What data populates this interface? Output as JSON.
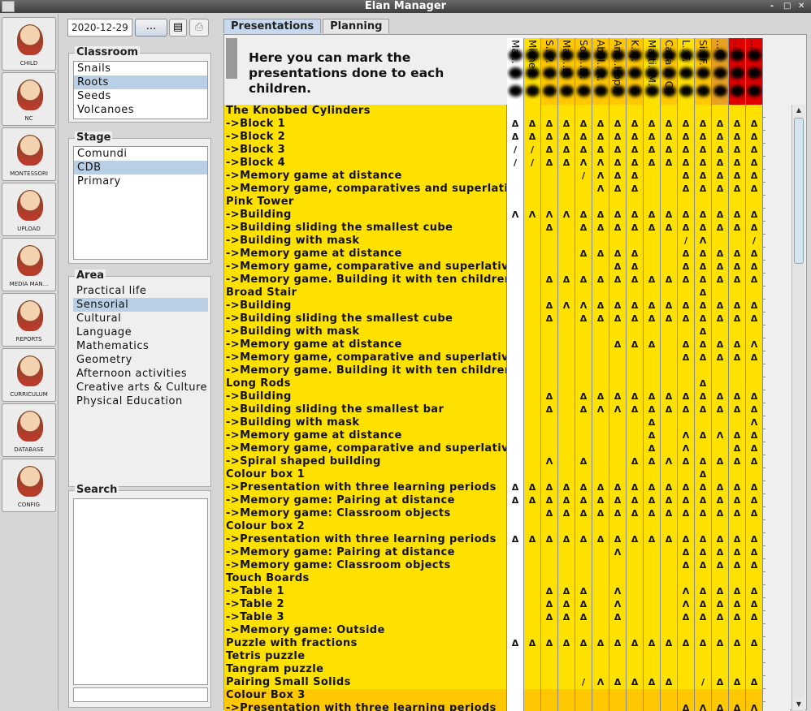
{
  "window": {
    "title": "Elan Manager",
    "controls": [
      "-",
      "□",
      "✕"
    ]
  },
  "sidebar": {
    "items": [
      {
        "label": "CHILD",
        "icon": "child-icon"
      },
      {
        "label": "NC",
        "icon": "nc-icon"
      },
      {
        "label": "MONTESSORI",
        "icon": "montessori-icon"
      },
      {
        "label": "UPLOAD",
        "icon": "upload-icon"
      },
      {
        "label": "MEDIA MAN...",
        "icon": "media-manager-icon"
      },
      {
        "label": "REPORTS",
        "icon": "reports-icon"
      },
      {
        "label": "CURRICULUM",
        "icon": "curriculum-icon"
      },
      {
        "label": "DATABASE",
        "icon": "database-icon"
      },
      {
        "label": "CONFIG",
        "icon": "config-icon"
      }
    ]
  },
  "toolbar": {
    "date": "2020-12-29",
    "dots_label": "...",
    "doc_icon": "document-icon",
    "print_icon": "print-icon"
  },
  "classroom": {
    "title": "Classroom",
    "items": [
      "Snails",
      "Roots",
      "Seeds",
      "Volcanoes"
    ],
    "selected": 1
  },
  "stage": {
    "title": "Stage",
    "items": [
      "Comundi",
      "CDB",
      "Primary"
    ],
    "selected": 1
  },
  "area": {
    "title": "Area",
    "items": [
      "Practical life",
      "Sensorial",
      "Cultural",
      "Language",
      "Mathematics",
      "Geometry",
      "Afternoon activities",
      "Creative arts & Culture",
      "Physical Education"
    ],
    "selected": 1
  },
  "search": {
    "title": "Search",
    "value": ""
  },
  "tabs": [
    {
      "label": "Presentations",
      "active": true
    },
    {
      "label": "Planning",
      "active": false
    }
  ],
  "header": {
    "text": "Here you can mark the presentations done to each children."
  },
  "students": [
    {
      "name": "Ma…"
    },
    {
      "name": "Miche…"
    },
    {
      "name": "S…P."
    },
    {
      "name": "Mar…D."
    },
    {
      "name": "Sofi…M."
    },
    {
      "name": "Abril…R."
    },
    {
      "name": "Ant…Hop."
    },
    {
      "name": "K…J."
    },
    {
      "name": "Marti…M."
    },
    {
      "name": "Carla A. C."
    },
    {
      "name": "L…F."
    },
    {
      "name": "Si…F."
    },
    {
      "name": "…G."
    },
    {
      "name": "…"
    },
    {
      "name": "…"
    }
  ],
  "colors": {
    "yellow": "#ffe100",
    "orange": "#ffc800",
    "dark_orange": "#e8a020",
    "red": "#e00000",
    "white": "#ffffff"
  },
  "rows": [
    {
      "label": "The Knobbed Cylinders",
      "cells": ""
    },
    {
      "label": "->Block 1",
      "cells": "ΔΔΔΔΔΔΔΔΔΔΔΔΔΔΔ"
    },
    {
      "label": "->Block 2",
      "cells": "ΔΔΔΔΔΔΔΔΔΔΔΔΔΔΔ"
    },
    {
      "label": "->Block 3",
      "cells": "//ΔΔΔΔΔΔΔΔΔΔΔΔΔ"
    },
    {
      "label": "->Block 4",
      "cells": "//ΔΔΛΛΔΔΔΔΔΔΔΔΔ"
    },
    {
      "label": "->Memory game at distance",
      "cells": "    /ΛΔΔ  ΔΔΔΔΔ"
    },
    {
      "label": "->Memory game, comparatives and superlatives",
      "cells": "     ΛΔΔ  ΔΔΔΔΔ"
    },
    {
      "label": "Pink Tower",
      "cells": ""
    },
    {
      "label": "->Building",
      "cells": "ΛΛΛΛΔΔΔΔΔΔΔΔΔΔΔ"
    },
    {
      "label": "->Building sliding the smallest cube",
      "cells": "  Δ ΔΔΔΔΔΔΔΔΔΔΔ"
    },
    {
      "label": "->Building with mask",
      "cells": "          /Λ  /"
    },
    {
      "label": "->Memory game at distance",
      "cells": "    ΔΔΔΔ  ΔΔΔΔΔ"
    },
    {
      "label": "->Memory game, comparative and superlative",
      "cells": "      ΔΔ  ΔΔΔΔΔ"
    },
    {
      "label": "->Memory game. Building it with ten children",
      "cells": "  ΔΔΔΔΔΔΔΔΔΔΔΔΔ"
    },
    {
      "label": "Broad Stair",
      "cells": "           Δ   "
    },
    {
      "label": "->Building",
      "cells": "  ΔΛΛΔΔΔΔΔΔΔΔΔΔ"
    },
    {
      "label": "->Building sliding the smallest cube",
      "cells": "  Δ ΔΔΔΔΔΔΔΔΔΔΔ"
    },
    {
      "label": "->Building with mask",
      "cells": "           Δ   "
    },
    {
      "label": "->Memory game at distance",
      "cells": "      ΔΔΔ ΔΔΔΔΛ"
    },
    {
      "label": "->Memory game, comparative and superlative",
      "cells": "          ΔΔΔΔΔ"
    },
    {
      "label": "->Memory game. Building it with ten children",
      "cells": ""
    },
    {
      "label": "Long Rods",
      "cells": "           Δ   "
    },
    {
      "label": "->Building",
      "cells": "  Δ ΔΔΔΔΔΔΔΔΔΔΔ"
    },
    {
      "label": "->Building sliding the smallest bar",
      "cells": "  Δ ΔΛΛΔΔΔΔΔΔΔΔ"
    },
    {
      "label": "->Building with mask",
      "cells": "        Δ     Λ"
    },
    {
      "label": "->Memory game at distance",
      "cells": "        Δ ΛΔΛΔΔ"
    },
    {
      "label": "->Memory game, comparative and superlative",
      "cells": "        Δ Λ  ΔΔ"
    },
    {
      "label": "->Spiral shaped building",
      "cells": "  Λ Δ  ΔΔΛΔΔΔΔΔ"
    },
    {
      "label": "Colour box 1",
      "cells": "           Δ   "
    },
    {
      "label": "->Presentation with three learning periods",
      "cells": "ΔΔΔΔΔΔΔΔΔΔΔΔΔΔΔ"
    },
    {
      "label": "->Memory game: Pairing at distance",
      "cells": "ΔΔΔΔΔΔΔΔΔΔΔΔΔΔΔ"
    },
    {
      "label": "->Memory game: Classroom objects",
      "cells": "  ΔΔΔΔΔΔΔΔΔΔΔΔΔ"
    },
    {
      "label": "Colour box 2",
      "cells": ""
    },
    {
      "label": "->Presentation with three learning periods",
      "cells": "ΔΔΔΔΔΔΔΔΔΔΔΔΔΔΔ"
    },
    {
      "label": "->Memory game: Pairing at distance",
      "cells": "      Λ   ΔΔΔΔΔ"
    },
    {
      "label": "->Memory game: Classroom objects",
      "cells": "          ΔΔΔΔΔ"
    },
    {
      "label": "Touch Boards",
      "cells": ""
    },
    {
      "label": "->Table 1",
      "cells": "  ΔΔΔ Λ   ΛΔΔΔΔ"
    },
    {
      "label": "->Table 2",
      "cells": "  ΔΔΔ Λ   ΛΔΔΔΔ"
    },
    {
      "label": "->Table 3",
      "cells": "  ΔΔΔ Δ   ΔΔΔΔΔ"
    },
    {
      "label": "->Memory game: Outside",
      "cells": ""
    },
    {
      "label": "Puzzle with fractions",
      "cells": "ΔΔΔΔΔΔΔΔΔΔΔΔΔΔΔ"
    },
    {
      "label": "Tetris puzzle",
      "cells": ""
    },
    {
      "label": "Tangram puzzle",
      "cells": ""
    },
    {
      "label": "Pairing Small Solids",
      "cells": "    /ΛΔΔΔΔ /ΔΔΔ"
    },
    {
      "label": "Colour Box 3",
      "cells": ""
    },
    {
      "label": "->Presentation with three learning periods",
      "cells": "          ΔΛΔΔΛ"
    }
  ]
}
